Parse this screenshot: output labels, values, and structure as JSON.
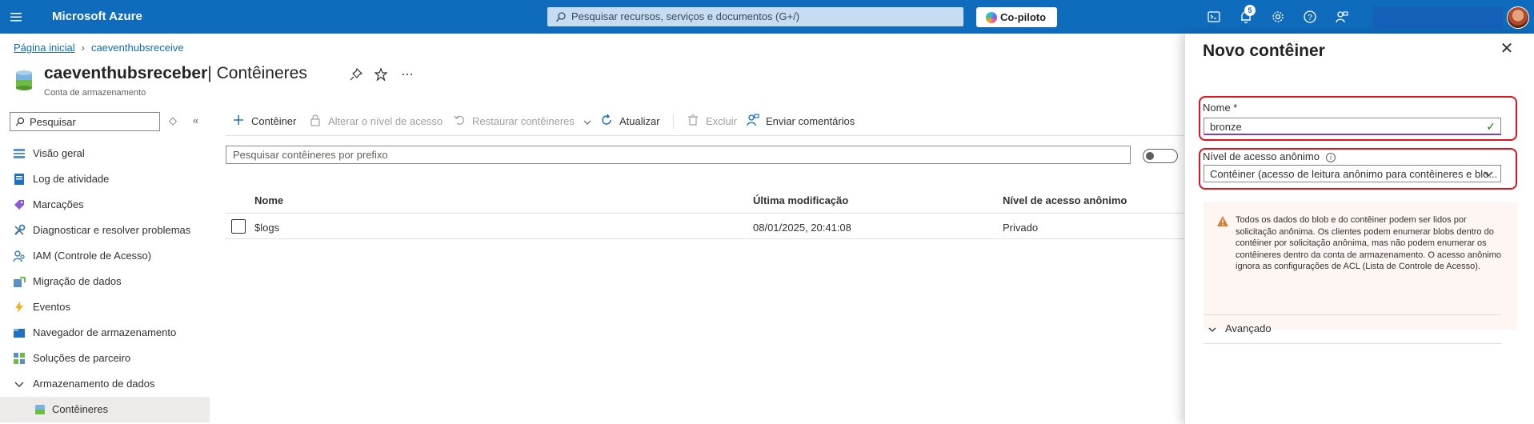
{
  "topbar": {
    "brand": "Microsoft Azure",
    "search_placeholder": "Pesquisar recursos, serviços e documentos (G+/)",
    "copilot_label": "Co-piloto",
    "notification_count": "5"
  },
  "breadcrumb": {
    "home": "Página inicial",
    "current": "caeventhubsreceive"
  },
  "header": {
    "resource_name": "caeventhubsreceber",
    "separator": "|",
    "section": "Contêineres",
    "subtitle": "Conta de armazenamento"
  },
  "sidebar": {
    "search_placeholder": "Pesquisar",
    "items": [
      {
        "label": "Visão geral",
        "icon": "overview-icon"
      },
      {
        "label": "Log de atividade",
        "icon": "activity-log-icon"
      },
      {
        "label": "Marcações",
        "icon": "tag-icon"
      },
      {
        "label": "Diagnosticar e resolver problemas",
        "icon": "wrench-icon"
      },
      {
        "label": "IAM (Controle de Acesso)",
        "icon": "iam-icon"
      },
      {
        "label": "Migração de dados",
        "icon": "data-migration-icon"
      },
      {
        "label": "Eventos",
        "icon": "lightning-icon"
      },
      {
        "label": "Navegador de armazenamento",
        "icon": "storage-browser-icon"
      },
      {
        "label": "Soluções de parceiro",
        "icon": "partner-icon"
      },
      {
        "label": "Armazenamento de dados",
        "icon": "chevron-down-icon"
      },
      {
        "label": "Contêineres",
        "icon": "container-icon"
      }
    ]
  },
  "commands": {
    "add_container": "Contêiner",
    "change_access": "Alterar o nível de acesso",
    "restore": "Restaurar contêineres",
    "refresh": "Atualizar",
    "delete": "Excluir",
    "feedback": "Enviar comentários"
  },
  "filter": {
    "placeholder": "Pesquisar contêineres por prefixo"
  },
  "table": {
    "headers": [
      "Nome",
      "Última modificação",
      "Nível de acesso anônimo"
    ],
    "rows": [
      {
        "name": "$logs",
        "modified": "08/01/2025, 20:41:08",
        "access": "Privado"
      }
    ]
  },
  "panel": {
    "title": "Novo contêiner",
    "name_label": "Nome *",
    "name_value": "bronze",
    "access_label": "Nível de acesso anônimo",
    "access_value": "Contêiner (acesso de leitura anônimo para contêineres e blo...",
    "warning_text": "Todos os dados do blob e do contêiner podem ser lidos por solicitação anônima. Os clientes podem enumerar blobs dentro do contêiner por solicitação anônima, mas não podem enumerar os contêineres dentro da conta de armazenamento. O acesso anônimo ignora as configurações de ACL (Lista de Controle de Acesso).",
    "advanced_label": "Avançado"
  },
  "colors": {
    "azure_blue": "#0f6cbd",
    "highlight_red": "#e0141d",
    "warning_bg": "#fdf6f3",
    "warning_icon": "#d67f3c"
  }
}
